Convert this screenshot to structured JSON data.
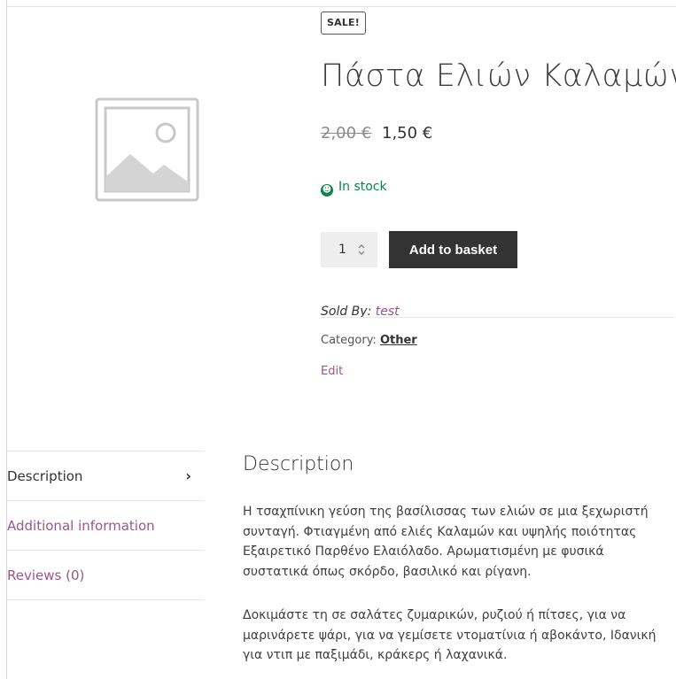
{
  "product": {
    "badge": "SALE!",
    "title": "Πάστα Ελιών Καλαμών",
    "old_price": "2,00 €",
    "new_price": "1,50 €",
    "stock": "In stock",
    "quantity": "1",
    "add_to_basket": "Add to basket",
    "sold_by_label": "Sold By:",
    "sold_by_vendor": "test",
    "category_label": "Category:",
    "category_value": "Other",
    "edit_label": "Edit"
  },
  "tabs": [
    {
      "label": "Description"
    },
    {
      "label": "Additional information"
    },
    {
      "label": "Reviews (0)"
    }
  ],
  "description": {
    "heading": "Description",
    "paragraphs": [
      "Η τσαχπίνικη γεύση της βασίλισσας των ελιών σε μια ξεχωριστή συνταγή. Φτιαγμένη από ελιές Καλαμών και υψηλής ποιότητας Εξαιρετικό Παρθένο Ελαιόλαδο. Αρωματισμένη με φυσικά συστατικά όπως σκόρδο, βασιλικό και ρίγανη.",
      "Δοκιμάστε τη σε σαλάτες ζυμαρικών, ρυζιού ή πίτσες, για να μαρινάρετε ψάρι, για να γεμίσετε ντοματίνια ή αβοκάντο, Ιδανική για ντιπ με παξιμάδι, κράκερς ή λαχανικά."
    ]
  },
  "colors": {
    "accent": "#96588a",
    "stock": "#0f834d",
    "button": "#333333"
  },
  "icons": {
    "image_placeholder": "image-placeholder-icon",
    "stock": "check-circle-icon",
    "spinner": "spinner-arrows-icon",
    "tab_arrow": "chevron-right-icon"
  }
}
